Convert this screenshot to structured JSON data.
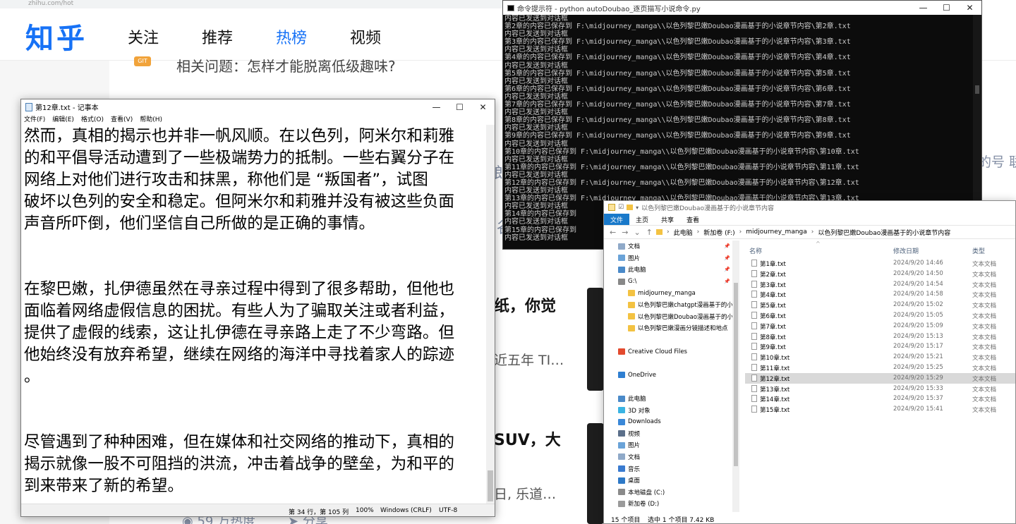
{
  "zhihu": {
    "url": "zhihu.com/hot",
    "logo": "知乎",
    "nav": [
      "关注",
      "推荐",
      "热榜",
      "视频"
    ],
    "nav_active": 2,
    "badge": "GIT",
    "related_question": "相关问题：怎样才能脱离低级趣味?",
    "frag_title1": "纸，你觉",
    "frag_sub1": "近五年 TI…",
    "frag_title2": "SUV，大",
    "frag_sub2": "日, 乐道…",
    "frag_heat": "59 万热度",
    "frag_share": "分享",
    "frag_right": "的号  联",
    "frag_mid1": "郎",
    "frag_mid2": "谷"
  },
  "notepad": {
    "title": "第12章.txt - 记事本",
    "menu": [
      "文件(F)",
      "编辑(E)",
      "格式(O)",
      "查看(V)",
      "帮助(H)"
    ],
    "lines": [
      "然而，真相的揭示也并非一帆风顺。在以色列，阿米尔和莉雅",
      "的和平倡导活动遭到了一些极端势力的抵制。一些右翼分子在",
      "网络上对他们进行攻击和抹黑，称他们是 “叛国者”，试图",
      "破坏以色列的安全和稳定。但阿米尔和莉雅并没有被这些负面",
      "声音所吓倒，他们坚信自己所做的是正确的事情。",
      "",
      "",
      "在黎巴嫩，扎伊德虽然在寻亲过程中得到了很多帮助，但他也",
      "面临着网络虚假信息的困扰。有些人为了骗取关注或者利益，",
      "提供了虚假的线索，这让扎伊德在寻亲路上走了不少弯路。但",
      "他始终没有放弃希望，继续在网络的海洋中寻找着家人的踪迹",
      "。",
      "",
      "",
      "尽管遇到了种种困难，但在媒体和社交网络的推动下，真相的",
      "揭示就像一股不可阻挡的洪流，冲击着战争的壁垒，为和平的",
      "到来带来了新的希望。"
    ],
    "status_pos": "第 34 行，第 105 列",
    "status_zoom": "100%",
    "status_eol": "Windows (CRLF)",
    "status_enc": "UTF-8"
  },
  "cmd": {
    "title": "命令提示符 - python  autoDoubao_逐页描写小说命令.py",
    "text": "内容已发送到对话框\n第2章的内容已保存到 F:\\midjourney_manga\\\\以色列黎巴嫩Doubao漫画基于的小说章节内容\\第2章.txt\n内容已发送到对话框\n第3章的内容已保存到 F:\\midjourney_manga\\\\以色列黎巴嫩Doubao漫画基于的小说章节内容\\第3章.txt\n内容已发送到对话框\n第4章的内容已保存到 F:\\midjourney_manga\\\\以色列黎巴嫩Doubao漫画基于的小说章节内容\\第4章.txt\n内容已发送到对话框\n第5章的内容已保存到 F:\\midjourney_manga\\\\以色列黎巴嫩Doubao漫画基于的小说章节内容\\第5章.txt\n内容已发送到对话框\n第6章的内容已保存到 F:\\midjourney_manga\\\\以色列黎巴嫩Doubao漫画基于的小说章节内容\\第6章.txt\n内容已发送到对话框\n第7章的内容已保存到 F:\\midjourney_manga\\\\以色列黎巴嫩Doubao漫画基于的小说章节内容\\第7章.txt\n内容已发送到对话框\n第8章的内容已保存到 F:\\midjourney_manga\\\\以色列黎巴嫩Doubao漫画基于的小说章节内容\\第8章.txt\n内容已发送到对话框\n第9章的内容已保存到 F:\\midjourney_manga\\\\以色列黎巴嫩Doubao漫画基于的小说章节内容\\第9章.txt\n内容已发送到对话框\n第10章的内容已保存到 F:\\midjourney_manga\\\\以色列黎巴嫩Doubao漫画基于的小说章节内容\\第10章.txt\n内容已发送到对话框\n第11章的内容已保存到 F:\\midjourney_manga\\\\以色列黎巴嫩Doubao漫画基于的小说章节内容\\第11章.txt\n内容已发送到对话框\n第12章的内容已保存到 F:\\midjourney_manga\\\\以色列黎巴嫩Doubao漫画基于的小说章节内容\\第12章.txt\n内容已发送到对话框\n第13章的内容已保存到 F:\\midjourney_manga\\\\以色列黎巴嫩Doubao漫画基于的小说章节内容\\第13章.txt\n内容已发送到对话框\n第14章的内容已保存到\n内容已发送到对话框\n第15章的内容已保存到\n内容已发送到对话框"
  },
  "explorer": {
    "title": "以色列黎巴嫩Doubao漫画基于的小说章节内容",
    "tabs": [
      "文件",
      "主页",
      "共享",
      "查看"
    ],
    "breadcrumb": [
      "此电脑",
      "新加卷 (F:)",
      "midjourney_manga",
      "以色列黎巴嫩Doubao漫画基于的小说章节内容"
    ],
    "nav": [
      {
        "label": "文档",
        "color": "#8fa9c8",
        "pin": true
      },
      {
        "label": "图片",
        "color": "#6aa3d8",
        "pin": true
      },
      {
        "label": "此电脑",
        "color": "#4a8ac9",
        "pin": true
      },
      {
        "label": "G:\\",
        "color": "#888888",
        "pin": true
      },
      {
        "label": "midjourney_manga",
        "color": "#f3c242",
        "pin": false
      },
      {
        "label": "以色列黎巴嫩chatgpt漫画基于的小说",
        "color": "#f3c242",
        "pin": false
      },
      {
        "label": "以色列黎巴嫩Doubao漫画基于的小说",
        "color": "#f3c242",
        "pin": false
      },
      {
        "label": "以色列黎巴嫩漫画分镜描述和地点",
        "color": "#f3c242",
        "pin": false
      },
      {
        "label": "",
        "color": "transparent",
        "pin": false
      },
      {
        "label": "Creative Cloud Files",
        "color": "#e34a2e",
        "pin": false
      },
      {
        "label": "",
        "color": "transparent",
        "pin": false
      },
      {
        "label": "OneDrive",
        "color": "#2f7fd1",
        "pin": false
      },
      {
        "label": "",
        "color": "transparent",
        "pin": false
      },
      {
        "label": "此电脑",
        "color": "#4a8ac9",
        "pin": false
      },
      {
        "label": "3D 对象",
        "color": "#3ab4e3",
        "pin": false
      },
      {
        "label": "Downloads",
        "color": "#3a88d8",
        "pin": false
      },
      {
        "label": "视频",
        "color": "#5b6f8a",
        "pin": false
      },
      {
        "label": "图片",
        "color": "#6aa3d8",
        "pin": false
      },
      {
        "label": "文档",
        "color": "#8fa9c8",
        "pin": false
      },
      {
        "label": "音乐",
        "color": "#3a7bd0",
        "pin": false
      },
      {
        "label": "桌面",
        "color": "#2e79c7",
        "pin": false
      },
      {
        "label": "本地磁盘 (C:)",
        "color": "#8a8a8a",
        "pin": false
      },
      {
        "label": "新加卷 (D:)",
        "color": "#9a9a9a",
        "pin": false
      },
      {
        "label": "新加卷 (E:)",
        "color": "#9a9a9a",
        "pin": false
      },
      {
        "label": "新加卷 (F:)",
        "color": "#9a9a9a",
        "pin": false,
        "selected": true
      }
    ],
    "columns": [
      "名称",
      "修改日期",
      "类型"
    ],
    "files": [
      {
        "name": "第1章.txt",
        "date": "2024/9/20 14:46",
        "type": "文本文档"
      },
      {
        "name": "第2章.txt",
        "date": "2024/9/20 14:50",
        "type": "文本文档"
      },
      {
        "name": "第3章.txt",
        "date": "2024/9/20 14:54",
        "type": "文本文档"
      },
      {
        "name": "第4章.txt",
        "date": "2024/9/20 14:58",
        "type": "文本文档"
      },
      {
        "name": "第5章.txt",
        "date": "2024/9/20 15:02",
        "type": "文本文档"
      },
      {
        "name": "第6章.txt",
        "date": "2024/9/20 15:05",
        "type": "文本文档"
      },
      {
        "name": "第7章.txt",
        "date": "2024/9/20 15:09",
        "type": "文本文档"
      },
      {
        "name": "第8章.txt",
        "date": "2024/9/20 15:13",
        "type": "文本文档"
      },
      {
        "name": "第9章.txt",
        "date": "2024/9/20 15:17",
        "type": "文本文档"
      },
      {
        "name": "第10章.txt",
        "date": "2024/9/20 15:21",
        "type": "文本文档"
      },
      {
        "name": "第11章.txt",
        "date": "2024/9/20 15:25",
        "type": "文本文档"
      },
      {
        "name": "第12章.txt",
        "date": "2024/9/20 15:29",
        "type": "文本文档",
        "selected": true
      },
      {
        "name": "第13章.txt",
        "date": "2024/9/20 15:33",
        "type": "文本文档"
      },
      {
        "name": "第14章.txt",
        "date": "2024/9/20 15:37",
        "type": "文本文档"
      },
      {
        "name": "第15章.txt",
        "date": "2024/9/20 15:41",
        "type": "文本文档"
      }
    ],
    "status_count": "15 个项目",
    "status_sel": "选中 1 个项目  7.42 KB"
  },
  "win": {
    "min": "—",
    "max": "☐",
    "close": "✕"
  }
}
